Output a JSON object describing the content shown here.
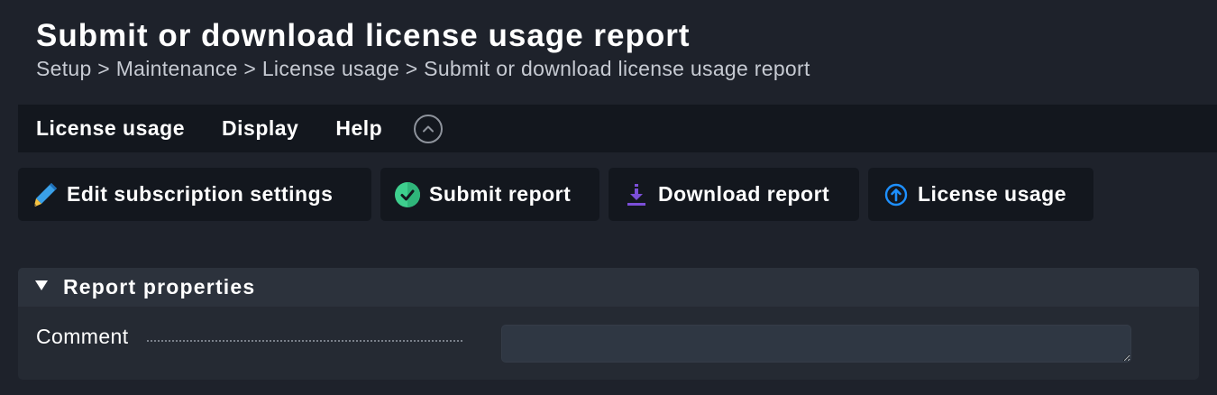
{
  "header": {
    "title": "Submit or download license usage report",
    "breadcrumb": "Setup > Maintenance > License usage > Submit or download license usage report"
  },
  "menubar": {
    "items": [
      "License usage",
      "Display",
      "Help"
    ],
    "collapse_icon": "chevron-up-circle-icon"
  },
  "toolbar": {
    "buttons": [
      {
        "label": "Edit subscription settings",
        "icon": "pencil-icon"
      },
      {
        "label": "Submit report",
        "icon": "check-circle-icon"
      },
      {
        "label": "Download report",
        "icon": "download-icon"
      },
      {
        "label": "License usage",
        "icon": "arrow-up-circle-icon"
      }
    ]
  },
  "panel": {
    "title": "Report properties",
    "expanded": true,
    "fields": [
      {
        "label": "Comment",
        "value": "",
        "placeholder": ""
      }
    ]
  },
  "colors": {
    "background": "#1e222b",
    "menubar": "#13171e",
    "panel": "#252a33",
    "panel_header": "#2c323c",
    "input": "#2f3743",
    "submit_green": "#3ecf8e",
    "download_purple": "#7b4fd8",
    "info_blue": "#1e90ff",
    "pencil_blue": "#3aa0e8",
    "pencil_yellow": "#f5c242"
  }
}
